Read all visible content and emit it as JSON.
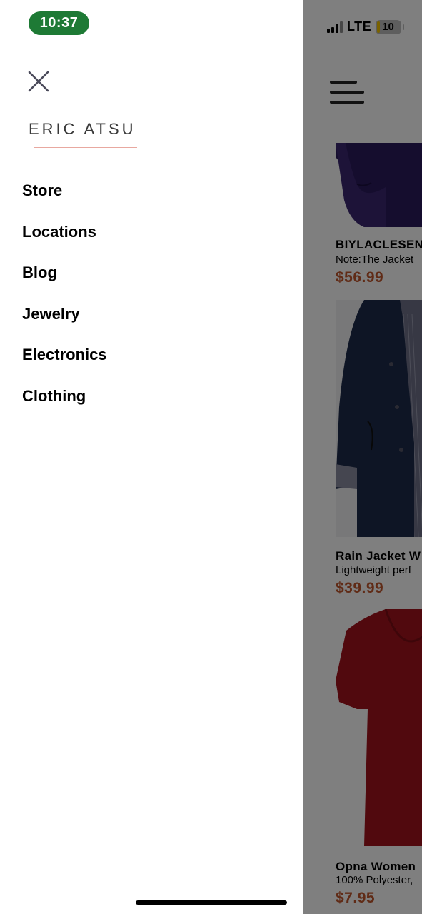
{
  "status_bar": {
    "time": "10:37",
    "network": "LTE",
    "battery": "10"
  },
  "drawer": {
    "brand": "ERIC ATSU",
    "menu": [
      {
        "label": "Store"
      },
      {
        "label": "Locations"
      },
      {
        "label": "Blog"
      },
      {
        "label": "Jewelry"
      },
      {
        "label": "Electronics"
      },
      {
        "label": "Clothing"
      }
    ]
  },
  "products": [
    {
      "title": "BIYLACLESEN",
      "description": "Note:The Jacket",
      "price": "$56.99"
    },
    {
      "title": "Rain Jacket W",
      "description": "Lightweight perf",
      "price": "$39.99"
    },
    {
      "title": "Opna Women",
      "description": "100% Polyester,",
      "price": "$7.95"
    }
  ],
  "colors": {
    "price": "#c0562d",
    "time_pill": "#1e7a35",
    "brand_underline": "#e8a8a0"
  },
  "icons": {
    "close": "close-icon",
    "menu": "hamburger-icon",
    "signal": "signal-icon",
    "battery": "battery-icon"
  }
}
